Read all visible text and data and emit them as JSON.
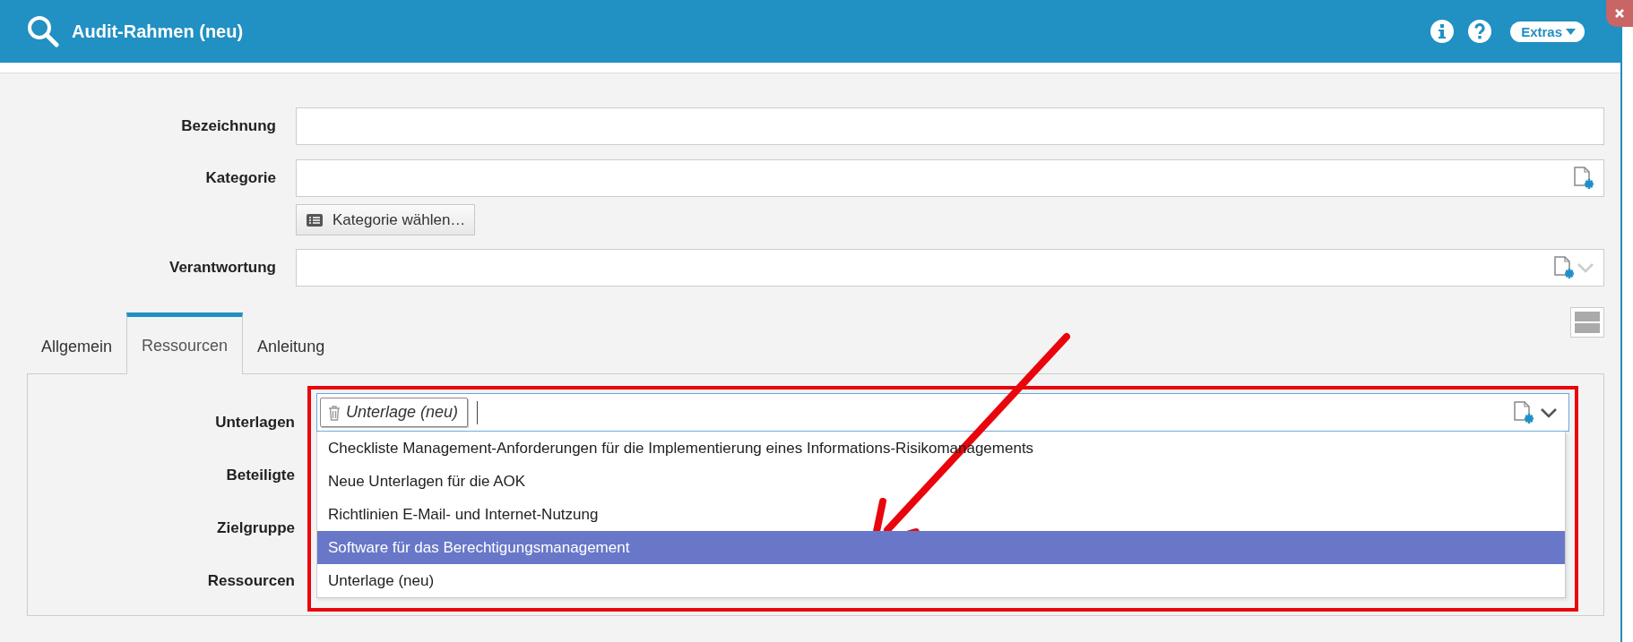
{
  "window": {
    "title": "Audit-Rahmen (neu)",
    "extras": "Extras"
  },
  "fields": [
    {
      "label": "Bezeichnung",
      "kind": "text"
    },
    {
      "label": "Kategorie",
      "kind": "picker",
      "button": "Kategorie wählen…"
    },
    {
      "label": "Verantwortung",
      "kind": "select"
    }
  ],
  "tabs": [
    {
      "label": "Allgemein",
      "selected": false
    },
    {
      "label": "Ressourcen",
      "selected": true
    },
    {
      "label": "Anleitung",
      "selected": false
    }
  ],
  "resources": {
    "labels": [
      "Unterlagen",
      "Beteiligte",
      "Zielgruppe",
      "Ressourcen"
    ],
    "chip": "Unterlage (neu)",
    "options": [
      {
        "label": "Checkliste Management-Anforderungen für die Implementierung eines Informations-Risikomanagements",
        "selected": false
      },
      {
        "label": "Neue Unterlagen für die AOK",
        "selected": false
      },
      {
        "label": "Richtlinien E-Mail- und Internet-Nutzung",
        "selected": false
      },
      {
        "label": "Software für das Berechtigungsmanagement",
        "selected": true
      },
      {
        "label": "Unterlage (neu)",
        "selected": false
      }
    ]
  }
}
